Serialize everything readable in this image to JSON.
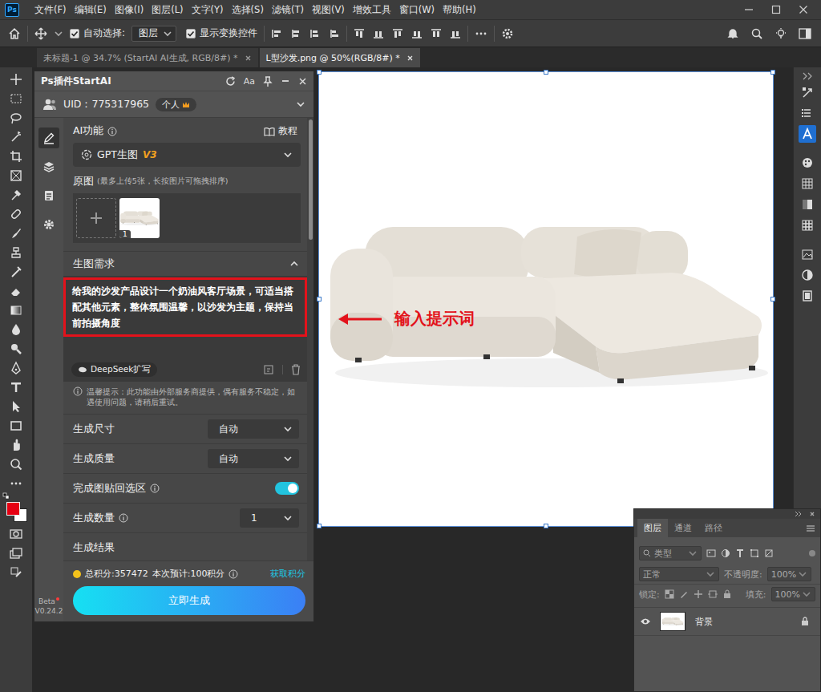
{
  "app": {
    "logo": "Ps"
  },
  "menu": [
    "文件(F)",
    "编辑(E)",
    "图像(I)",
    "图层(L)",
    "文字(Y)",
    "选择(S)",
    "滤镜(T)",
    "视图(V)",
    "增效工具",
    "窗口(W)",
    "帮助(H)"
  ],
  "options_bar": {
    "auto_select": {
      "label": "自动选择:",
      "checked": true
    },
    "target": "图层",
    "show_transform": {
      "label": "显示变换控件",
      "checked": true
    }
  },
  "tabs": [
    {
      "label": "未标题-1 @ 34.7% (StartAI AI生成, RGB/8#) *",
      "selected": false
    },
    {
      "label": "L型沙发.png @ 50%(RGB/8#) *",
      "selected": true
    }
  ],
  "tools": {
    "foreground_color": "#e60012",
    "background_color": "#ffffff"
  },
  "right_dock": {
    "items": [
      {
        "selected": false
      },
      {
        "selected": false
      },
      {
        "selected": true
      },
      {
        "selected": false
      },
      {
        "selected": false
      },
      {
        "selected": false
      },
      {
        "selected": false
      },
      {
        "selected": false
      },
      {
        "selected": false
      },
      {
        "selected": false
      }
    ]
  },
  "plugin": {
    "title": "Ps插件StartAI",
    "font_button": "Aa",
    "uid": "UID：775317965",
    "account_badge": "个人",
    "nav": [
      {
        "selected": true
      },
      {
        "selected": false
      },
      {
        "selected": false
      },
      {
        "selected": false
      }
    ],
    "beta": "Beta",
    "version": "V0.24.2",
    "ai_function_label": "AI功能",
    "tutorial": "教程",
    "model": "GPT生图",
    "model_version": "V3",
    "source_label": "原图",
    "source_hint": "(最多上传5张，长按图片可拖拽排序)",
    "thumb_index": "1",
    "prompt_section": {
      "label": "生图需求",
      "expanded": true
    },
    "prompt": "给我的沙发产品设计一个奶油风客厅场景，可适当搭配其他元素，整体氛围温馨，以沙发为主题，保持当前拍摄角度",
    "deepseek": "DeepSeek扩写",
    "notice": "温馨提示：此功能由外部服务商提供，偶有服务不稳定，如遇使用问题，请稍后重试。",
    "settings": [
      {
        "kind": "select",
        "label": "生成尺寸",
        "value": "自动",
        "info": false
      },
      {
        "kind": "select",
        "label": "生成质量",
        "value": "自动",
        "info": false
      },
      {
        "kind": "toggle",
        "label": "完成图贴回选区",
        "on": true,
        "info": true
      },
      {
        "kind": "select",
        "label": "生成数量",
        "value": "1",
        "info": true
      }
    ],
    "partial_row": "生成结果",
    "credits": {
      "total": "总积分:357472",
      "estimate": "本次预计:100积分",
      "get": "获取积分"
    },
    "generate": "立即生成"
  },
  "canvas": {
    "annotation": "输入提示词"
  },
  "layers_panel": {
    "tabs": [
      {
        "label": "图层",
        "selected": true
      },
      {
        "label": "通道",
        "selected": false
      },
      {
        "label": "路径",
        "selected": false
      }
    ],
    "filter": "类型",
    "blend": "正常",
    "opacity_label": "不透明度:",
    "opacity": "100%",
    "lock_label": "锁定:",
    "fill_label": "填充:",
    "fill": "100%",
    "layers": [
      {
        "name": "背景",
        "visible": true,
        "locked": true
      }
    ]
  }
}
